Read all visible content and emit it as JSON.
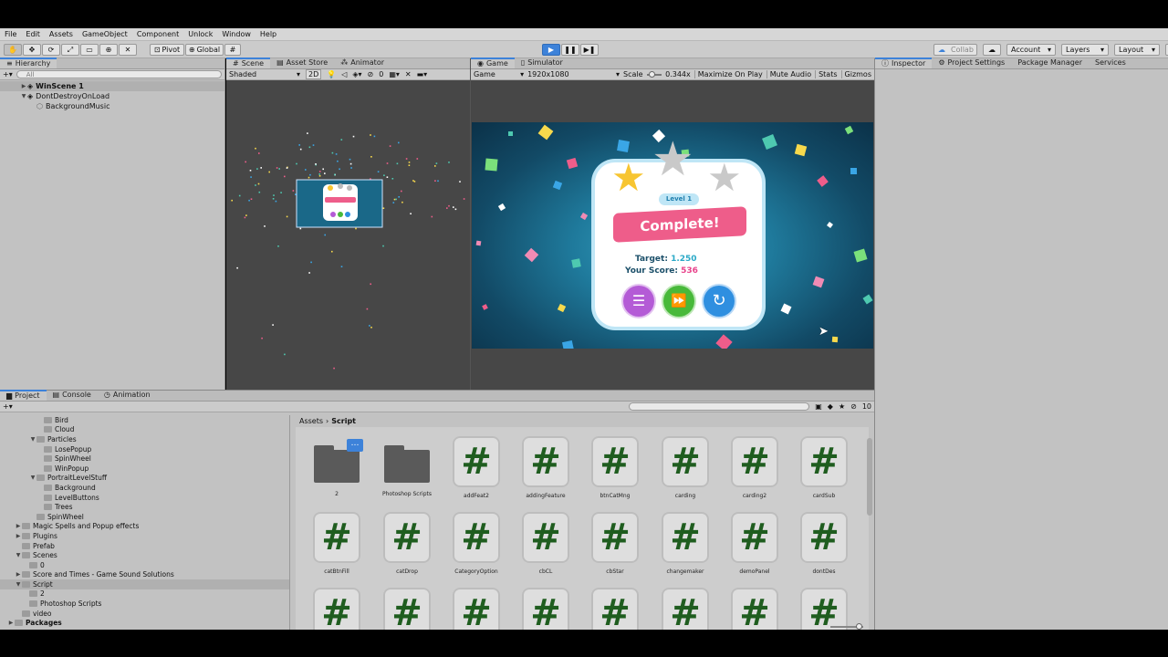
{
  "menu": [
    "File",
    "Edit",
    "Assets",
    "GameObject",
    "Component",
    "Unlock",
    "Window",
    "Help"
  ],
  "toolbar": {
    "pivot": "Pivot",
    "global": "Global",
    "collab": "Collab",
    "account": "Account",
    "layers": "Layers",
    "layout": "Layout"
  },
  "hierarchy": {
    "tab": "Hierarchy",
    "search_placeholder": "All",
    "items": [
      {
        "label": "WinScene 1",
        "depth": 0
      },
      {
        "label": "DontDestroyOnLoad",
        "depth": 0
      },
      {
        "label": "BackgroundMusic",
        "depth": 1
      }
    ]
  },
  "scene": {
    "tabs": [
      "Scene",
      "Asset Store",
      "Animator"
    ],
    "shading": "Shaded",
    "mode2d": "2D",
    "count": "0"
  },
  "game": {
    "tabs": [
      "Game",
      "Simulator"
    ],
    "display": "Game",
    "resolution": "1920x1080",
    "scale_label": "Scale",
    "scale_value": "0.344x",
    "options": [
      "Maximize On Play",
      "Mute Audio",
      "Stats",
      "Gizmos"
    ],
    "popup": {
      "level": "Level 1",
      "banner": "Complete!",
      "target_label": "Target:",
      "target_value": "1.250",
      "score_label": "Your Score:",
      "score_value": "536"
    }
  },
  "inspector": {
    "tabs": [
      "Inspector",
      "Project Settings",
      "Package Manager",
      "Services"
    ]
  },
  "project": {
    "tabs": [
      "Project",
      "Console",
      "Animation"
    ],
    "breadcrumb": [
      "Assets",
      "Script"
    ],
    "count": "10",
    "tree": [
      {
        "label": "Bird",
        "indent": 4,
        "arrow": ""
      },
      {
        "label": "Cloud",
        "indent": 4,
        "arrow": ""
      },
      {
        "label": "Particles",
        "indent": 3,
        "arrow": "▼"
      },
      {
        "label": "LosePopup",
        "indent": 4,
        "arrow": ""
      },
      {
        "label": "SpinWheel",
        "indent": 4,
        "arrow": ""
      },
      {
        "label": "WinPopup",
        "indent": 4,
        "arrow": ""
      },
      {
        "label": "PortraitLevelStuff",
        "indent": 3,
        "arrow": "▼"
      },
      {
        "label": "Background",
        "indent": 4,
        "arrow": ""
      },
      {
        "label": "LevelButtons",
        "indent": 4,
        "arrow": ""
      },
      {
        "label": "Trees",
        "indent": 4,
        "arrow": ""
      },
      {
        "label": "SpinWheel",
        "indent": 3,
        "arrow": ""
      },
      {
        "label": "Magic Spells and Popup effects",
        "indent": 1,
        "arrow": "▶"
      },
      {
        "label": "Plugins",
        "indent": 1,
        "arrow": "▶"
      },
      {
        "label": "Prefab",
        "indent": 1,
        "arrow": ""
      },
      {
        "label": "Scenes",
        "indent": 1,
        "arrow": "▼"
      },
      {
        "label": "0",
        "indent": 2,
        "arrow": ""
      },
      {
        "label": "Score and Times - Game Sound Solutions",
        "indent": 1,
        "arrow": "▶"
      },
      {
        "label": "Script",
        "indent": 1,
        "arrow": "▼"
      },
      {
        "label": "2",
        "indent": 2,
        "arrow": ""
      },
      {
        "label": "Photoshop Scripts",
        "indent": 2,
        "arrow": ""
      },
      {
        "label": "video",
        "indent": 1,
        "arrow": ""
      },
      {
        "label": "Packages",
        "indent": 0,
        "arrow": "▶"
      }
    ],
    "assets_row1": [
      "2",
      "Photoshop Scripts",
      "addFeat2",
      "addingFeature",
      "btnCatMng",
      "carding",
      "carding2",
      "cardSub"
    ],
    "assets_row2": [
      "catBtnFill",
      "catDrop",
      "CategoryOption",
      "cbCL",
      "cbStar",
      "changemaker",
      "demoPanel",
      "dontDes"
    ]
  },
  "colors": {
    "accent": "#3d82d9",
    "banner": "#ee5d8a",
    "score": "#e8438b",
    "target": "#2aa9c7",
    "btn_list": "#b45bd6",
    "btn_next": "#48b93a",
    "btn_restart": "#2f8fe0"
  }
}
